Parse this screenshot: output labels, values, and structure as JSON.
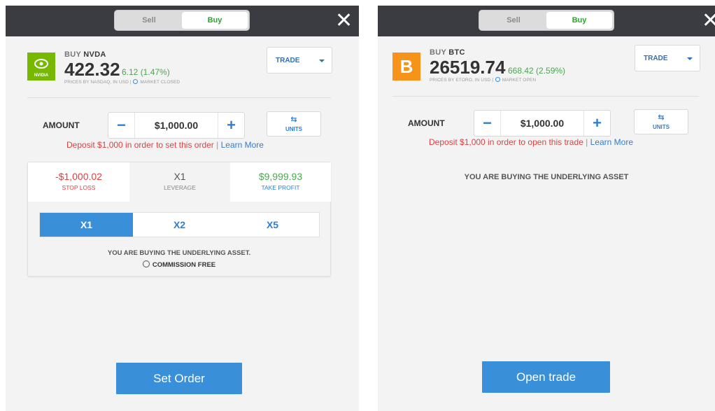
{
  "left": {
    "toggle": {
      "sell": "Sell",
      "buy": "Buy"
    },
    "close": "✕",
    "instrument": {
      "action": "BUY",
      "ticker": "NVDA",
      "logo_text": "NVIDIA",
      "price": "422.32",
      "change": "6.12 (1.47%)",
      "source": "PRICES BY NASDAQ, IN USD |",
      "market_status": "MARKET CLOSED"
    },
    "order_type": "TRADE",
    "amount_label": "AMOUNT",
    "amount_value": "$1,000.00",
    "units_label": "UNITS",
    "deposit_msg": "Deposit $1,000 in order to set this order",
    "learn_more": "Learn More",
    "stop_loss": {
      "value": "-$1,000.02",
      "label": "STOP LOSS"
    },
    "leverage": {
      "value": "X1",
      "label": "LEVERAGE"
    },
    "take_profit": {
      "value": "$9,999.93",
      "label": "TAKE PROFIT"
    },
    "leverage_options": [
      "X1",
      "X2",
      "X5"
    ],
    "info_line": "YOU ARE BUYING THE UNDERLYING ASSET.",
    "commission": "COMMISSION FREE",
    "submit": "Set Order"
  },
  "right": {
    "toggle": {
      "sell": "Sell",
      "buy": "Buy"
    },
    "close": "✕",
    "instrument": {
      "action": "BUY",
      "ticker": "BTC",
      "logo_text": "B",
      "price": "26519.74",
      "change": "668.42 (2.59%)",
      "source": "PRICES BY ETORO, IN USD |",
      "market_status": "MARKET OPEN"
    },
    "order_type": "TRADE",
    "amount_label": "AMOUNT",
    "amount_value": "$1,000.00",
    "units_label": "UNITS",
    "deposit_msg": "Deposit $1,000 in order to open this trade",
    "learn_more": "Learn More",
    "info_line": "YOU ARE BUYING THE UNDERLYING ASSET",
    "submit": "Open trade"
  },
  "colors": {
    "topbar": "#3a3c41",
    "buy_green": "#49a84c",
    "accent_blue": "#3a8fd9",
    "loss_red": "#e04040",
    "nvidia_green": "#76b900",
    "bitcoin_orange": "#f7931a"
  },
  "icons": [
    "close-icon",
    "chevron-down-icon",
    "swap-arrows-icon",
    "clock-icon",
    "commission-icon",
    "nvidia-logo",
    "bitcoin-logo"
  ]
}
